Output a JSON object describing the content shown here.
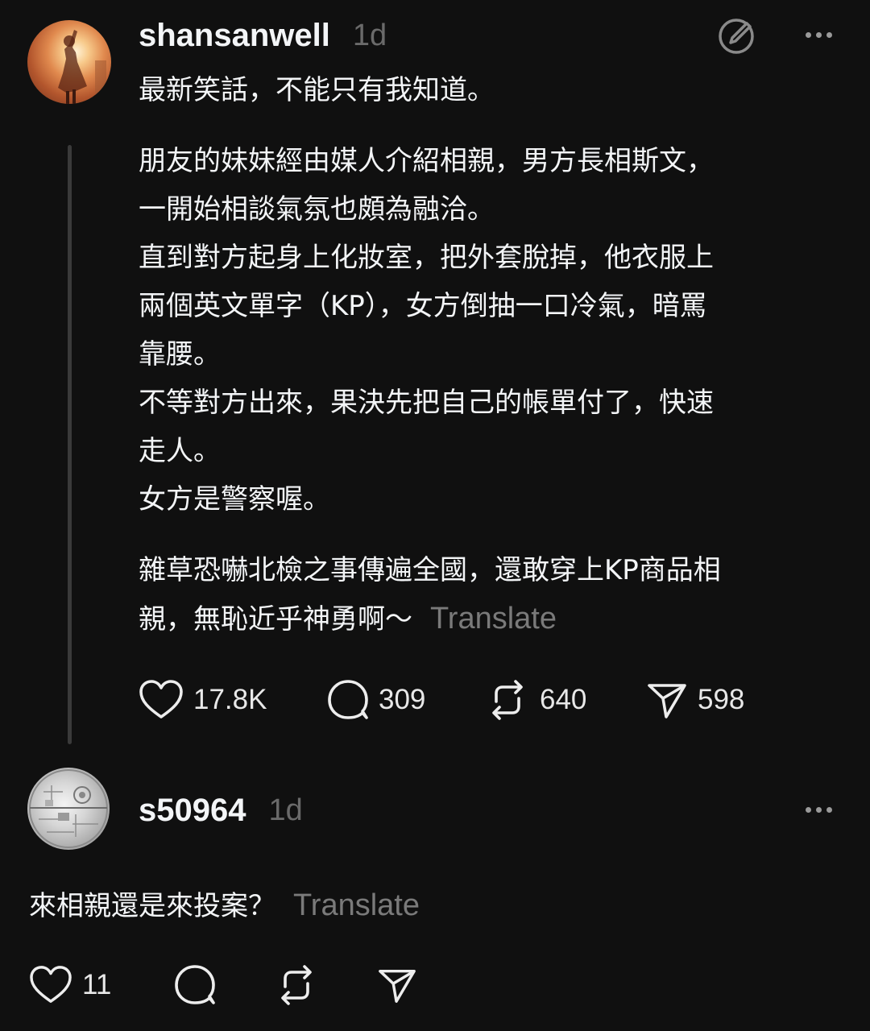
{
  "post": {
    "username": "shansanwell",
    "time": "1d",
    "title": "最新笑話，不能只有我知道。",
    "paragraph1": [
      "朋友的妹妹經由媒人介紹相親，男方長相斯文，",
      "一開始相談氣氛也頗為融洽。",
      "直到對方起身上化妝室，把外套脫掉，他衣服上",
      "兩個英文單字（KP），女方倒抽一口冷氣，暗罵",
      "靠腰。",
      "不等對方出來，果決先把自己的帳單付了，快速",
      "走人。",
      "女方是警察喔。"
    ],
    "paragraph2_line1": "雜草恐嚇北檢之事傳遍全國，還敢穿上KP商品相",
    "paragraph2_line2": "親，無恥近乎神勇啊～",
    "translate_label": "Translate",
    "likes": "17.8K",
    "comments": "309",
    "reposts": "640",
    "shares": "598"
  },
  "reply": {
    "username": "s50964",
    "time": "1d",
    "text": "來相親還是來投案？",
    "translate_label": "Translate",
    "likes": "11"
  },
  "icons": {
    "more": "more-horizontal-icon",
    "like": "heart-icon",
    "comment": "comment-bubble-icon",
    "repost": "repost-icon",
    "share": "send-icon",
    "edit": "edit-circle-icon"
  }
}
